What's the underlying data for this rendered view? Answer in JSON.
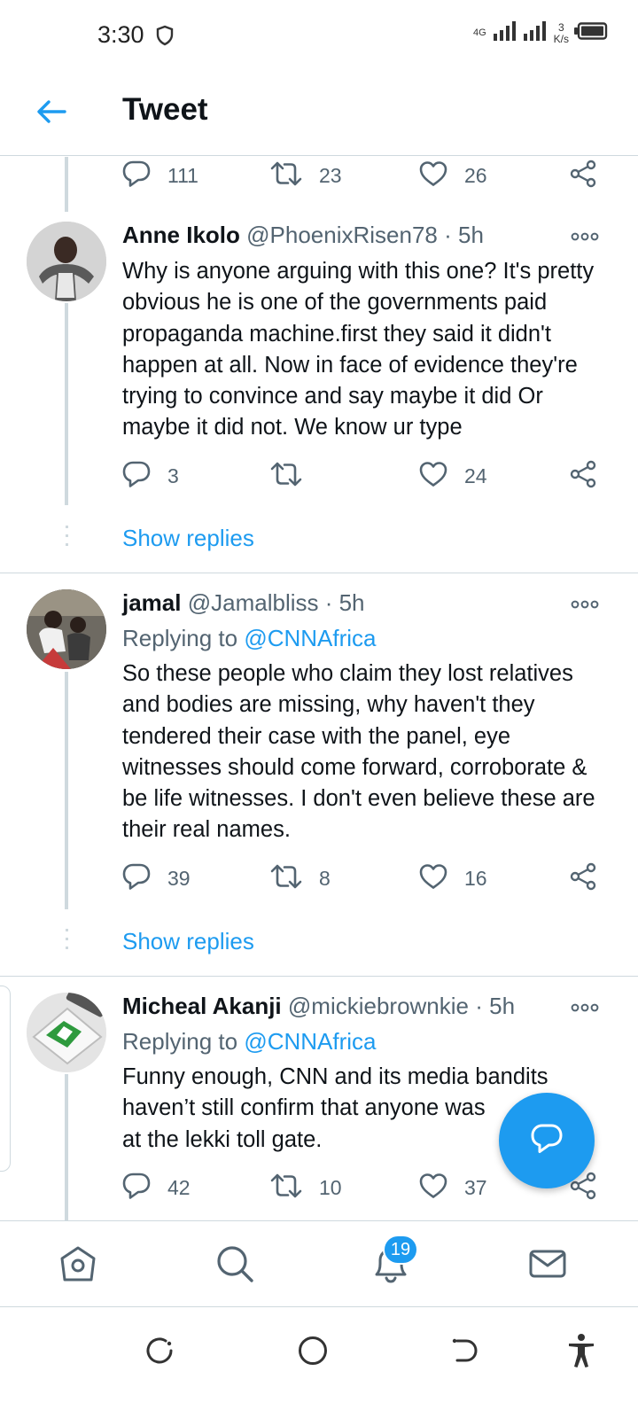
{
  "status_bar": {
    "time": "3:30",
    "network_label": "4G",
    "speed_value": "3",
    "speed_unit": "K/s"
  },
  "header": {
    "title": "Tweet"
  },
  "colors": {
    "accent": "#1d9bf0",
    "text_primary": "#0f1419",
    "text_secondary": "#536471",
    "divider": "#cfd9de"
  },
  "top_actions": {
    "replies": "111",
    "retweets": "23",
    "likes": "26"
  },
  "tweets": [
    {
      "name": "Anne Ikolo",
      "handle": "@PhoenixRisen78 · 5h",
      "body": "Why is anyone arguing with this one? It's pretty obvious he is one of the governments paid propaganda machine.first they said it didn't happen at all. Now in face of evidence they're trying to convince and say maybe it did Or maybe it did not. We know ur type",
      "replies": "3",
      "retweets": "",
      "likes": "24",
      "show_replies": "Show replies"
    },
    {
      "name": "jamal",
      "handle": "@Jamalbliss · 5h",
      "replying_prefix": "Replying to",
      "replying_to": "@CNNAfrica",
      "body": "So these people who claim they lost relatives and bodies are missing, why haven't they tendered their case with the panel, eye witnesses should come forward, corroborate & be life witnesses. I don't even believe these are their real names.",
      "replies": "39",
      "retweets": "8",
      "likes": "16",
      "show_replies": "Show replies"
    },
    {
      "name": "Micheal Akanji",
      "handle": "@mickiebrownkie · 5h",
      "replying_prefix": "Replying to",
      "replying_to": "@CNNAfrica",
      "body_line1": "Funny enough, CNN and its media bandits",
      "body_line2": "haven’t still confirm that anyone was",
      "body_line3": "at the lekki toll gate.",
      "replies": "42",
      "retweets": "10",
      "likes": "37"
    }
  ],
  "tab_bar": {
    "notifications_badge": "19"
  }
}
